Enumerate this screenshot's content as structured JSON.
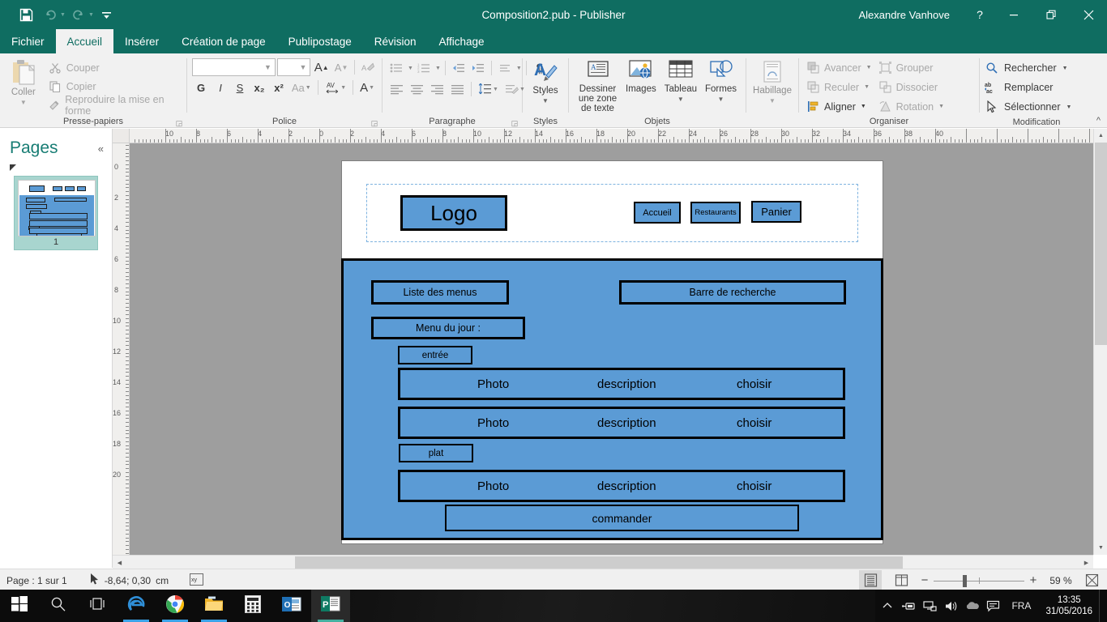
{
  "window": {
    "title": "Composition2.pub - Publisher",
    "user": "Alexandre Vanhove",
    "help": "?",
    "minimize": "minimize-icon",
    "restore": "restore-icon",
    "close": "close-icon"
  },
  "quick_access": {
    "save": "save-icon",
    "undo": "undo-icon",
    "redo": "redo-icon",
    "customize": "customize-qat-icon"
  },
  "ribbon": {
    "tabs": [
      {
        "label": "Fichier",
        "active": false
      },
      {
        "label": "Accueil",
        "active": true
      },
      {
        "label": "Insérer",
        "active": false
      },
      {
        "label": "Création de page",
        "active": false
      },
      {
        "label": "Publipostage",
        "active": false
      },
      {
        "label": "Révision",
        "active": false
      },
      {
        "label": "Affichage",
        "active": false
      }
    ],
    "collapse_label": "^",
    "groups": {
      "clipboard": {
        "label": "Presse-papiers",
        "paste": "Coller",
        "cut": "Couper",
        "copy": "Copier",
        "format_painter": "Reproduire la mise en forme"
      },
      "font": {
        "label": "Police",
        "font_name_value": "",
        "font_size_value": "",
        "grow": "A",
        "shrink": "A",
        "clear_format": "clear-formatting-icon",
        "bold": "G",
        "italic": "I",
        "underline": "S",
        "subscript": "x₂",
        "superscript": "x²",
        "change_case": "Aa",
        "char_spacing": "AV",
        "font_color": "A"
      },
      "paragraph": {
        "label": "Paragraphe",
        "bullets": "bullets-icon",
        "numbering": "numbering-icon",
        "decrease_indent": "decrease-indent-icon",
        "increase_indent": "increase-indent-icon",
        "hyphenation": "hyphenation-icon",
        "show_marks": "¶",
        "align_left": "align-left-icon",
        "align_center": "align-center-icon",
        "align_right": "align-right-icon",
        "justify": "justify-icon",
        "line_spacing": "line-spacing-icon",
        "baseline": "baseline-icon"
      },
      "styles": {
        "label": "Styles",
        "button": "Styles"
      },
      "objects": {
        "label": "Objets",
        "draw_text_box": "Dessiner une zone de texte",
        "images": "Images",
        "table": "Tableau",
        "shapes": "Formes"
      },
      "wrap": {
        "label": "",
        "button": "Habillage"
      },
      "arrange": {
        "label": "Organiser",
        "bring_forward": "Avancer",
        "send_backward": "Reculer",
        "align": "Aligner",
        "group": "Grouper",
        "ungroup": "Dissocier",
        "rotate": "Rotation"
      },
      "editing": {
        "label": "Modification",
        "find": "Rechercher",
        "replace": "Remplacer",
        "select": "Sélectionner"
      }
    }
  },
  "pages_pane": {
    "title": "Pages",
    "collapse": "«",
    "thumbnail_number": "1"
  },
  "rulers": {
    "horizontal_ticks": [
      "10",
      "8",
      "6",
      "4",
      "2",
      "0",
      "2",
      "4",
      "6",
      "8",
      "10",
      "12",
      "14",
      "16",
      "18",
      "20",
      "22",
      "24",
      "26",
      "28",
      "30",
      "32",
      "34",
      "36",
      "38",
      "40"
    ],
    "vertical_ticks": [
      "0",
      "2",
      "4",
      "6",
      "8",
      "10",
      "12",
      "14",
      "16",
      "18",
      "20"
    ],
    "unit": "cm"
  },
  "canvas": {
    "page_elements": {
      "logo": "Logo",
      "nav": [
        "Accueil",
        "Restaurants",
        "Panier"
      ],
      "menu_list": "Liste des menus",
      "search_bar": "Barre de recherche",
      "menu_of_day": "Menu du jour :",
      "section_starter": "entrée",
      "section_main": "plat",
      "rows": [
        {
          "photo": "Photo",
          "description": "description",
          "action": "choisir"
        },
        {
          "photo": "Photo",
          "description": "description",
          "action": "choisir"
        },
        {
          "photo": "Photo",
          "description": "description",
          "action": "choisir"
        }
      ],
      "order_button": "commander"
    },
    "accent_color": "#5b9bd5",
    "outline_color": "#000000"
  },
  "status_bar": {
    "page_text": "Page : 1 sur 1",
    "cursor_icon": "cursor-icon",
    "coordinates": "-8,64; 0,30",
    "unit": "cm",
    "special_chars_icon": "special-characters-icon",
    "view_single": "single-page-view-icon",
    "view_two": "two-page-spread-icon",
    "zoom_out": "−",
    "zoom_in": "+",
    "zoom_level": "59 %",
    "fit_page": "fit-page-icon"
  },
  "taskbar": {
    "items": [
      {
        "name": "start-button",
        "icon": "windows-logo-icon"
      },
      {
        "name": "search-button",
        "icon": "search-icon"
      },
      {
        "name": "task-view-button",
        "icon": "task-view-icon"
      },
      {
        "name": "edge-button",
        "icon": "edge-icon"
      },
      {
        "name": "chrome-button",
        "icon": "chrome-icon"
      },
      {
        "name": "file-explorer-button",
        "icon": "folder-icon"
      },
      {
        "name": "calculator-button",
        "icon": "calculator-icon"
      },
      {
        "name": "outlook-button",
        "icon": "outlook-icon"
      },
      {
        "name": "publisher-button",
        "icon": "publisher-icon"
      }
    ],
    "tray": {
      "show_hidden": "chevron-up-icon",
      "network_usb": "usb-icon",
      "network": "network-icon",
      "volume": "volume-icon",
      "onedrive": "onedrive-icon",
      "action_center": "action-center-icon",
      "language": "FRA",
      "time": "13:35",
      "date": "31/05/2016"
    }
  }
}
